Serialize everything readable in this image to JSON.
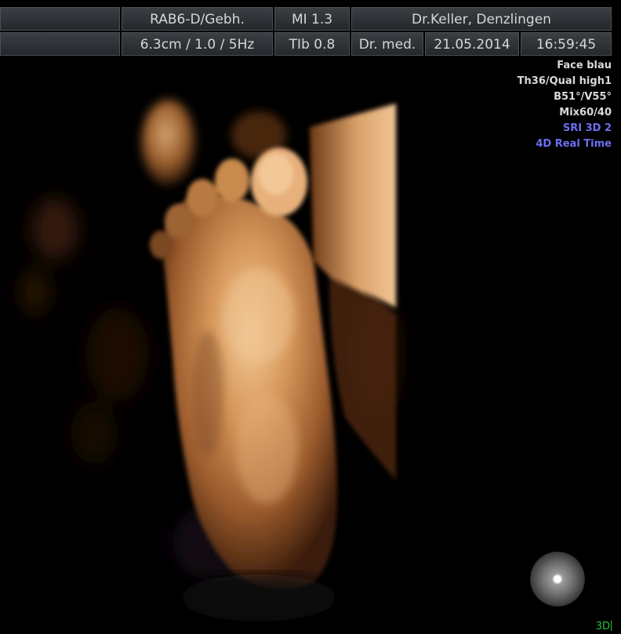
{
  "header": {
    "probe": "RAB6-D/Gebh.",
    "mi": "MI  1.3",
    "clinic": "Dr.Keller, Denzlingen",
    "depth": "6.3cm / 1.0 /  5Hz",
    "tib": "TIb  0.8",
    "title": "Dr. med.",
    "date": "21.05.2014",
    "time": "16:59:45"
  },
  "overlay": {
    "preset": "Face blau",
    "quality": "Th36/Qual high1",
    "angles": "B51°/V55°",
    "mix": "Mix60/40",
    "sri": "SRI 3D 2",
    "mode": "4D Real Time"
  },
  "footer": {
    "mode_label": "3D"
  },
  "colors": {
    "accent_blue": "#6b6ff0",
    "mode_green": "#28c23c",
    "skin_tone": "#c98a4e"
  },
  "icons": {
    "orientation": "orientation-sphere-icon"
  }
}
